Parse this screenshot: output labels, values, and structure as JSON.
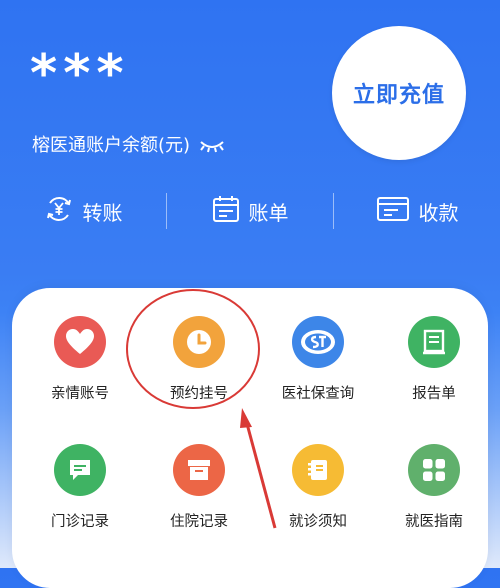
{
  "account": {
    "balance_masked": "***",
    "balance_label": "榕医通账户余额(元)",
    "recharge_label": "立即充值"
  },
  "actions": [
    {
      "label": "转账",
      "icon": "transfer-yen-icon"
    },
    {
      "label": "账单",
      "icon": "calendar-icon"
    },
    {
      "label": "收款",
      "icon": "receipt-card-icon"
    }
  ],
  "services": [
    {
      "label": "亲情账号",
      "icon": "heart-icon",
      "color": "#e95a55"
    },
    {
      "label": "预约挂号",
      "icon": "clock-icon",
      "color": "#f2a33c"
    },
    {
      "label": "医社保查询",
      "icon": "social-insurance-icon",
      "color": "#3d86e8"
    },
    {
      "label": "报告单",
      "icon": "report-icon",
      "color": "#3fb363"
    },
    {
      "label": "门诊记录",
      "icon": "chat-record-icon",
      "color": "#3fb363"
    },
    {
      "label": "住院记录",
      "icon": "archive-box-icon",
      "color": "#ec6646"
    },
    {
      "label": "就诊须知",
      "icon": "notice-book-icon",
      "color": "#f6bb34"
    },
    {
      "label": "就医指南",
      "icon": "grid-guide-icon",
      "color": "#60b06c"
    }
  ],
  "colors": {
    "header_blue": "#2f73f2",
    "annotation_red": "#d93a36"
  }
}
